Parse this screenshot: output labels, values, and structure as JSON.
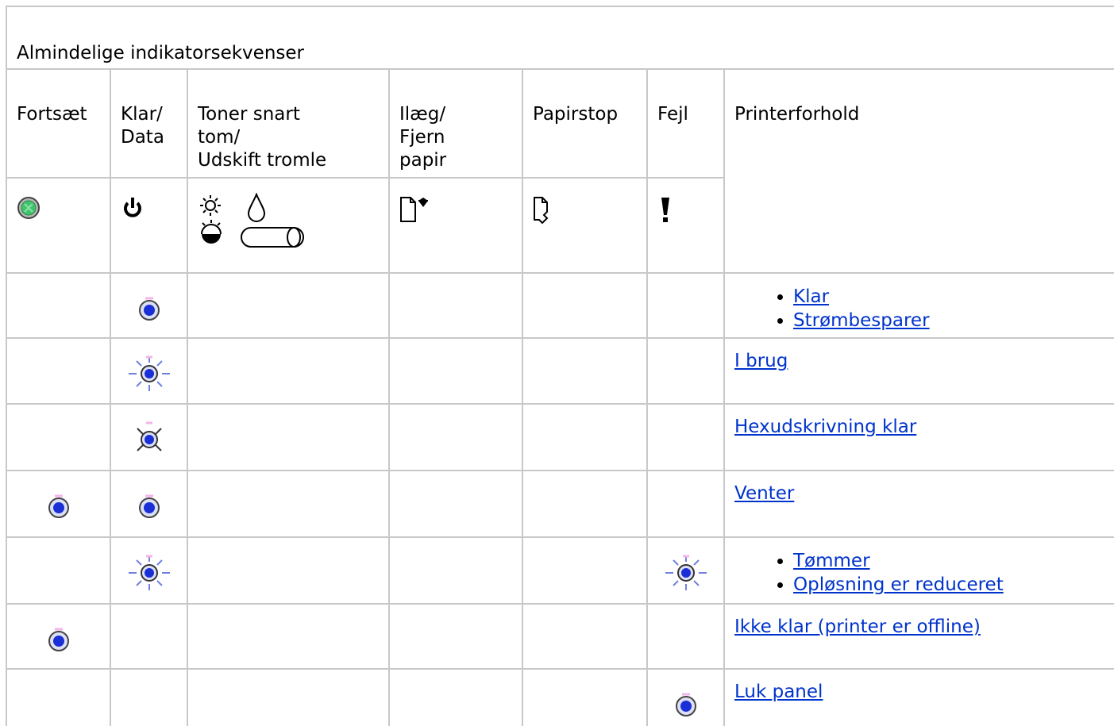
{
  "table": {
    "caption": "Almindelige indikatorsekvenser",
    "headers": {
      "continue": "Fortsæt",
      "ready_line1": "Klar/",
      "ready_line2": "Data",
      "toner_line1": "Toner snart",
      "toner_line2": "tom/",
      "toner_line3": "Udskift tromle",
      "load_line1": "Ilæg/",
      "load_line2": "Fjern",
      "load_line3": "papir",
      "paperjam": "Papirstop",
      "error": "Fejl",
      "condition": "Printerforhold"
    },
    "icon_names": {
      "continue": "continue-button-icon",
      "ready": "power-icon",
      "toner": "toner-drum-icon",
      "load": "load-paper-icon",
      "paperjam": "paper-jam-icon",
      "error": "exclamation-icon"
    },
    "rows": [
      {
        "continue": "",
        "ready": "on",
        "toner": "",
        "load": "",
        "paperjam": "",
        "error": "",
        "conditions": [
          "Klar",
          "Strømbesparer"
        ]
      },
      {
        "continue": "",
        "ready": "blink",
        "toner": "",
        "load": "",
        "paperjam": "",
        "error": "",
        "conditions": [
          "I brug"
        ]
      },
      {
        "continue": "",
        "ready": "slowblink",
        "toner": "",
        "load": "",
        "paperjam": "",
        "error": "",
        "conditions": [
          "Hexudskrivning klar"
        ]
      },
      {
        "continue": "on",
        "ready": "on",
        "toner": "",
        "load": "",
        "paperjam": "",
        "error": "",
        "conditions": [
          "Venter"
        ]
      },
      {
        "continue": "",
        "ready": "blink",
        "toner": "",
        "load": "",
        "paperjam": "",
        "error": "blink",
        "conditions": [
          "Tømmer",
          "Opløsning er reduceret"
        ]
      },
      {
        "continue": "on",
        "ready": "",
        "toner": "",
        "load": "",
        "paperjam": "",
        "error": "",
        "conditions": [
          "Ikke klar (printer er offline)"
        ]
      },
      {
        "continue": "",
        "ready": "",
        "toner": "",
        "load": "",
        "paperjam": "",
        "error": "on",
        "conditions": [
          "Luk panel"
        ]
      }
    ]
  },
  "colors": {
    "border": "#c8c8c8",
    "link": "#0033cc",
    "lamp_blue": "#1a2fd6",
    "continue_green": "#3ec46a"
  }
}
